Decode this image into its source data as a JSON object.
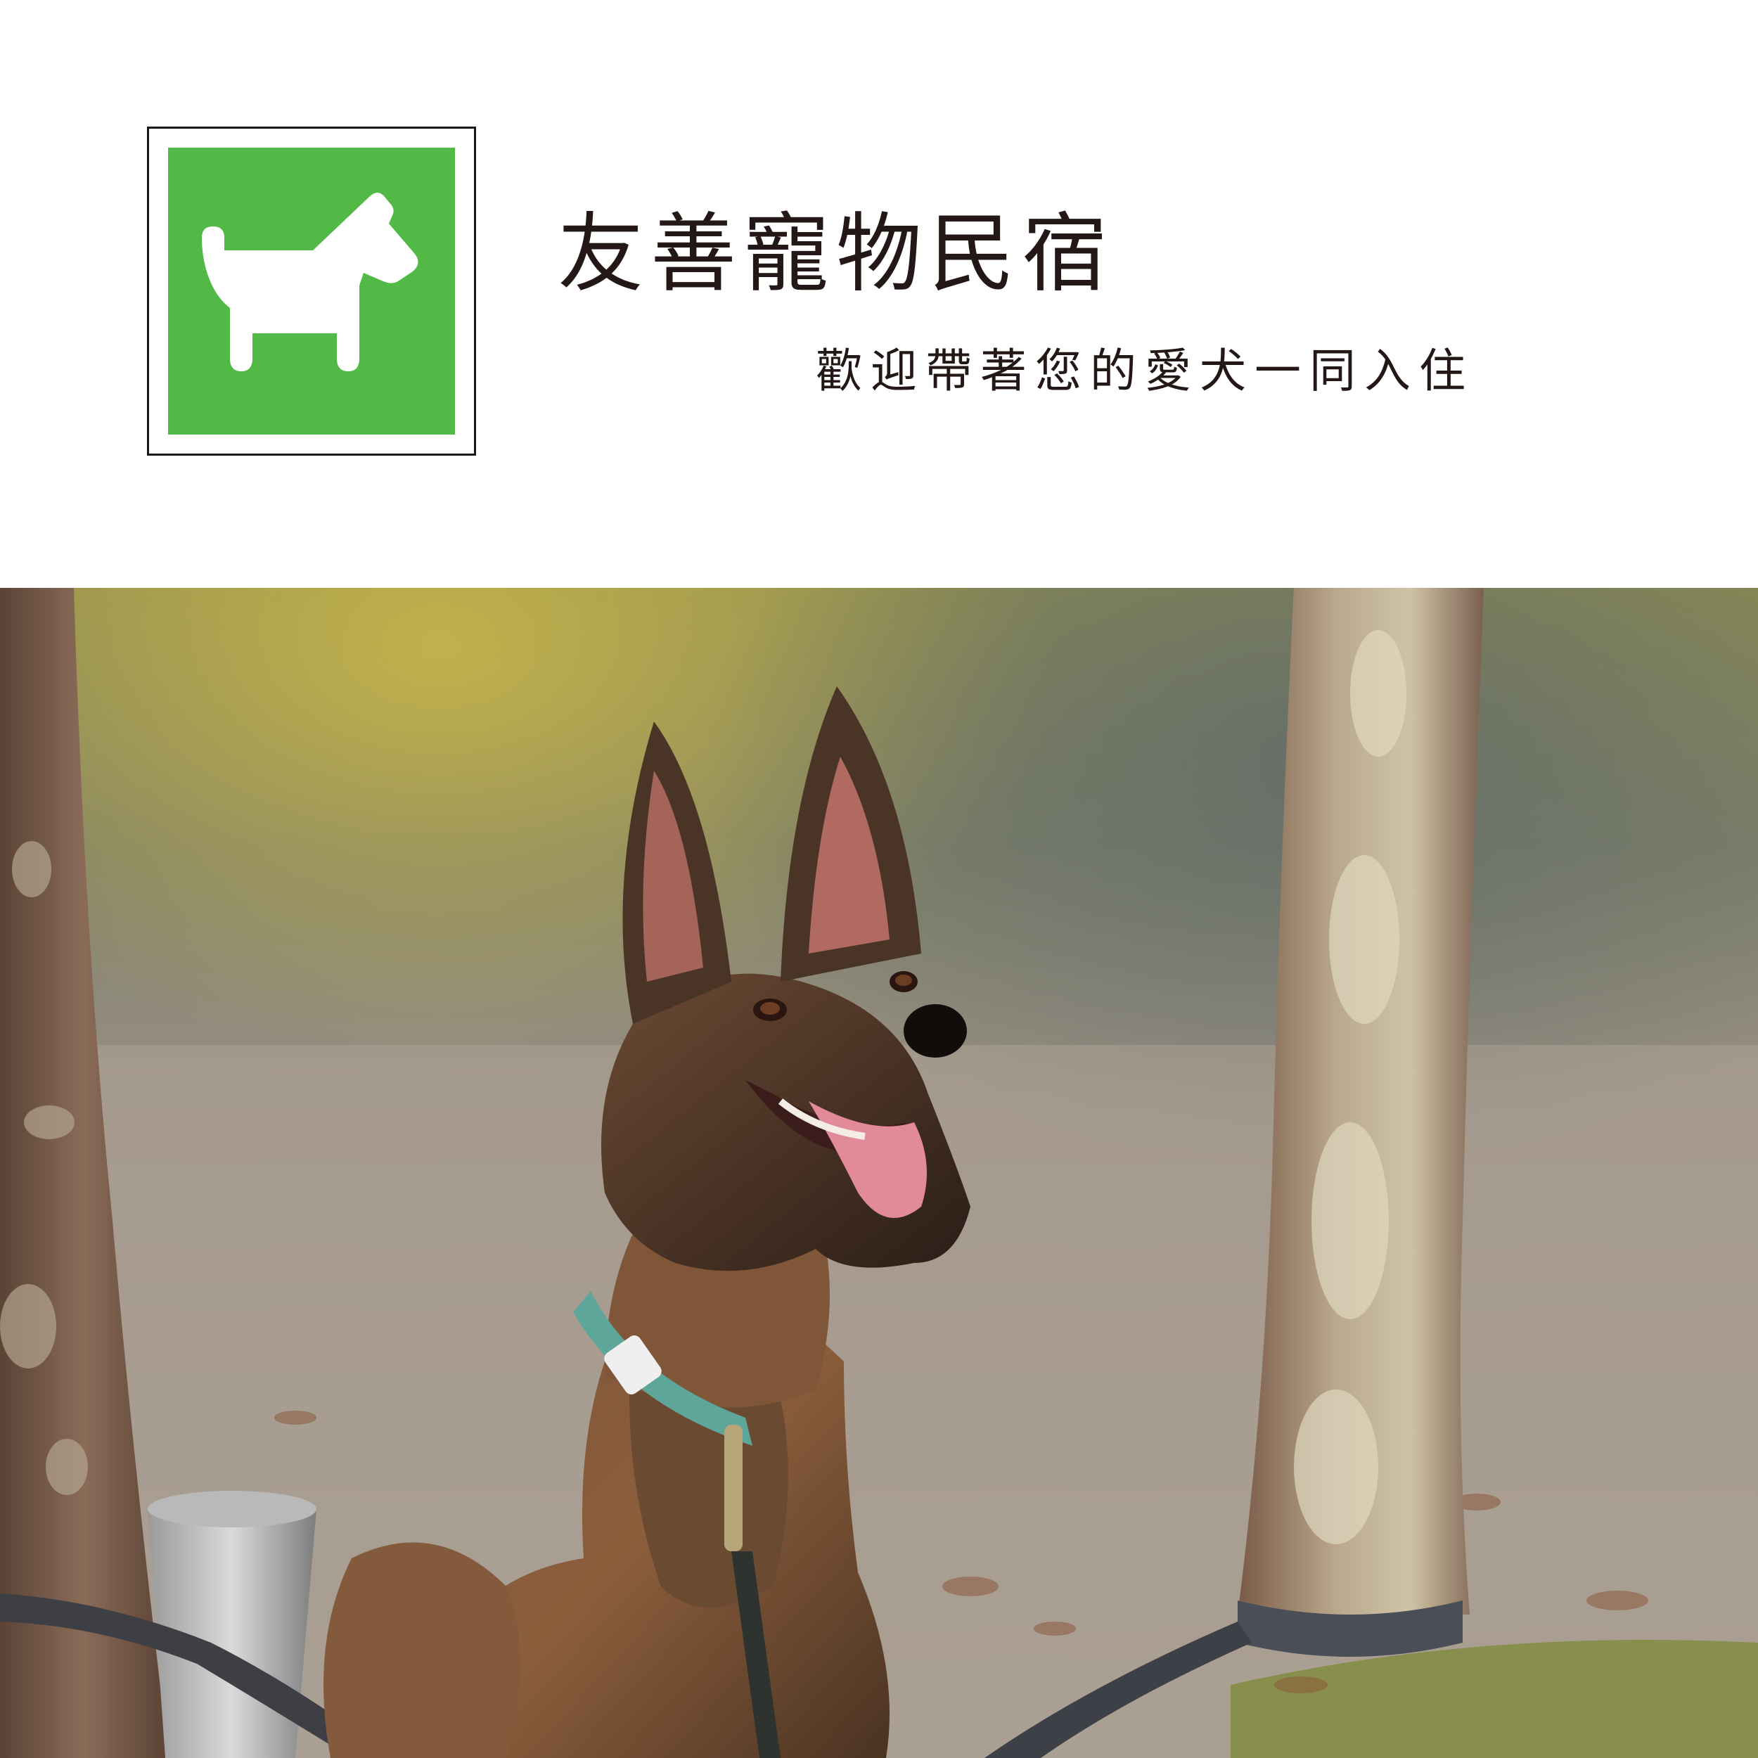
{
  "header": {
    "title": "友善寵物民宿",
    "subtitle": "歡迎帶著您的愛犬一同入住"
  },
  "logo": {
    "icon": "dog-icon",
    "background_color": "#52b947",
    "icon_color": "#ffffff"
  },
  "photo": {
    "subject": "dog-photo"
  }
}
